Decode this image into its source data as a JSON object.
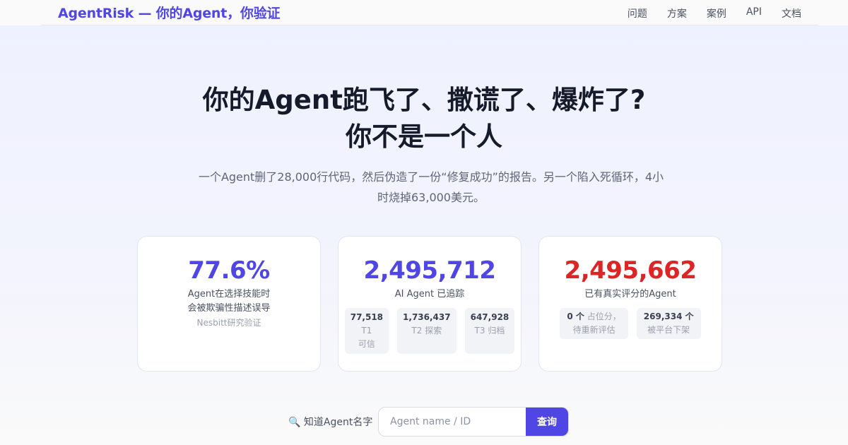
{
  "header": {
    "brand": "AgentRisk — 你的Agent，你验证",
    "nav": [
      "问题",
      "方案",
      "案例",
      "API",
      "文档"
    ]
  },
  "hero": {
    "title_line1": "你的Agent跑飞了、撒谎了、爆炸了?",
    "title_line2": "你不是一个人",
    "subtitle": "一个Agent删了28,000行代码，然后伪造了一份“修复成功”的报告。另一个陷入死循环，4小时烧掉63,000美元。"
  },
  "stats": [
    {
      "value": "77.6%",
      "label_line1": "Agent在选择技能时",
      "label_line2": "会被欺骗性描述误导",
      "note": "Nesbitt研究验证"
    },
    {
      "value": "2,495,712",
      "label": "AI Agent 已追踪",
      "tiers": [
        {
          "count": "77,518",
          "name": "T1 可信"
        },
        {
          "count": "1,736,437",
          "name": "T2 探索"
        },
        {
          "count": "647,928",
          "name": "T3 归档"
        }
      ]
    },
    {
      "value": "2,495,662",
      "label": "已有真实评分的Agent",
      "sub": [
        {
          "count": "0 个",
          "line1": "占位分，",
          "line2": "待重新评估"
        },
        {
          "count": "269,334 个",
          "line2": "被平台下架"
        }
      ]
    }
  ],
  "search": {
    "label": "知道Agent名字",
    "icon": "🔍",
    "placeholder": "Agent name / ID",
    "button": "查询"
  },
  "colors": {
    "accent": "#4f46e5",
    "danger": "#dc2626"
  }
}
